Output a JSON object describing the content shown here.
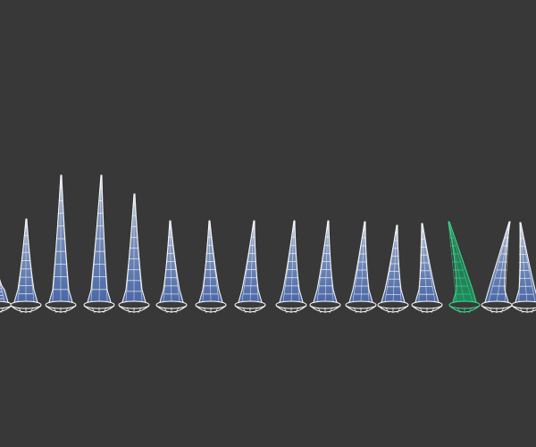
{
  "viewport": {
    "background": "#383838",
    "wire_color": "#ffffff",
    "fill_top": "#8fa3c4",
    "fill_bottom": "#4a6aa8",
    "selected_color": "#3ee08f"
  },
  "objects": {
    "count": 16,
    "selected_index": 13
  }
}
